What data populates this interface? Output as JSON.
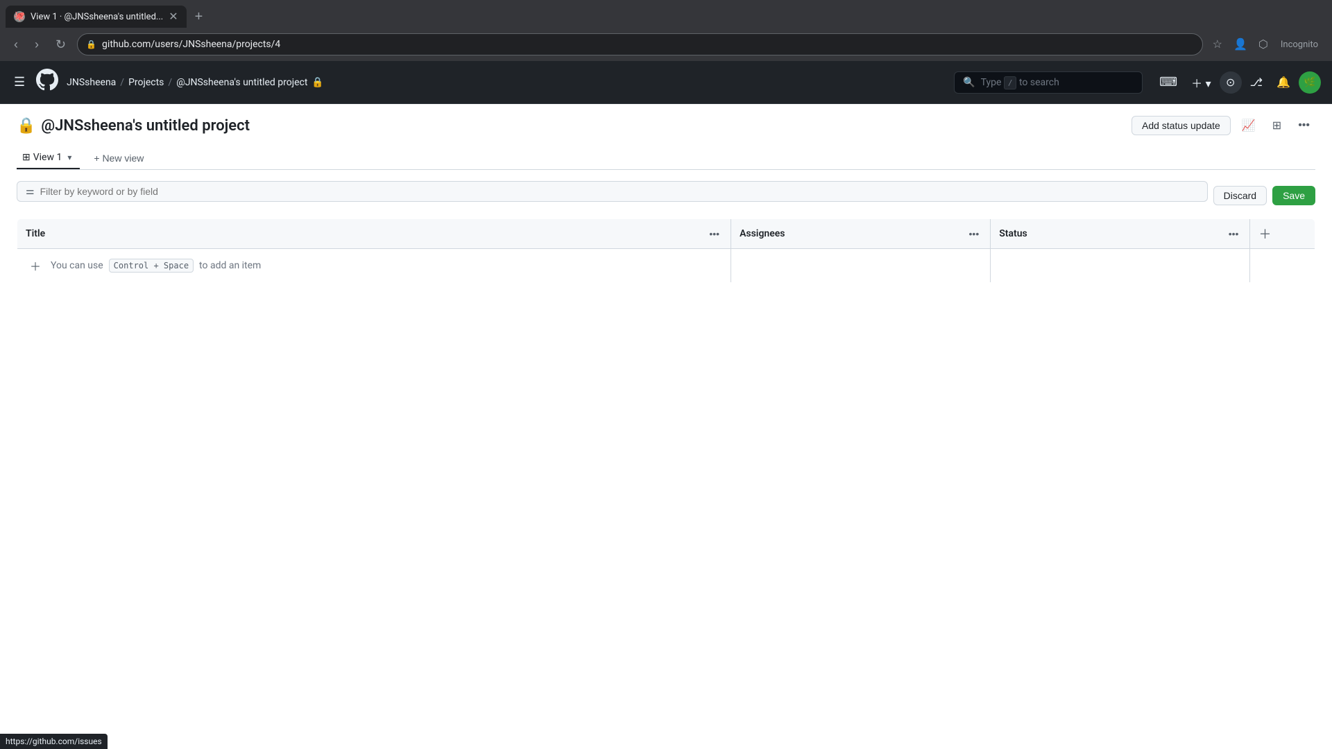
{
  "browser": {
    "tab": {
      "title": "View 1 · @JNSsheena's untitled...",
      "favicon": "🐙"
    },
    "address": "github.com/users/JNSsheena/projects/4",
    "new_tab_label": "+"
  },
  "github": {
    "header": {
      "user": "JNSsheena",
      "breadcrumb": {
        "user": "JNSsheena",
        "section": "Projects",
        "project": "@JNSsheena's untitled project"
      },
      "search_placeholder": "Type / to search",
      "search_shortcut": "/",
      "incognito_label": "Incognito"
    },
    "project": {
      "title": "@JNSsheena's untitled project",
      "lock_icon": "🔒",
      "status_update_btn": "Add status update",
      "views": [
        {
          "label": "View 1",
          "icon": "⊞",
          "active": true
        }
      ],
      "new_view_btn": "+ New view",
      "filter_placeholder": "Filter by keyword or by field",
      "discard_btn": "Discard",
      "save_btn": "Save",
      "table": {
        "columns": [
          {
            "label": "Title",
            "key": "title"
          },
          {
            "label": "Assignees",
            "key": "assignees"
          },
          {
            "label": "Status",
            "key": "status"
          }
        ],
        "rows": [],
        "add_item_hint": "You can use",
        "add_item_shortcut": "Control + Space",
        "add_item_suffix": "to add an item"
      }
    }
  },
  "status_bar": {
    "url": "https://github.com/issues"
  }
}
